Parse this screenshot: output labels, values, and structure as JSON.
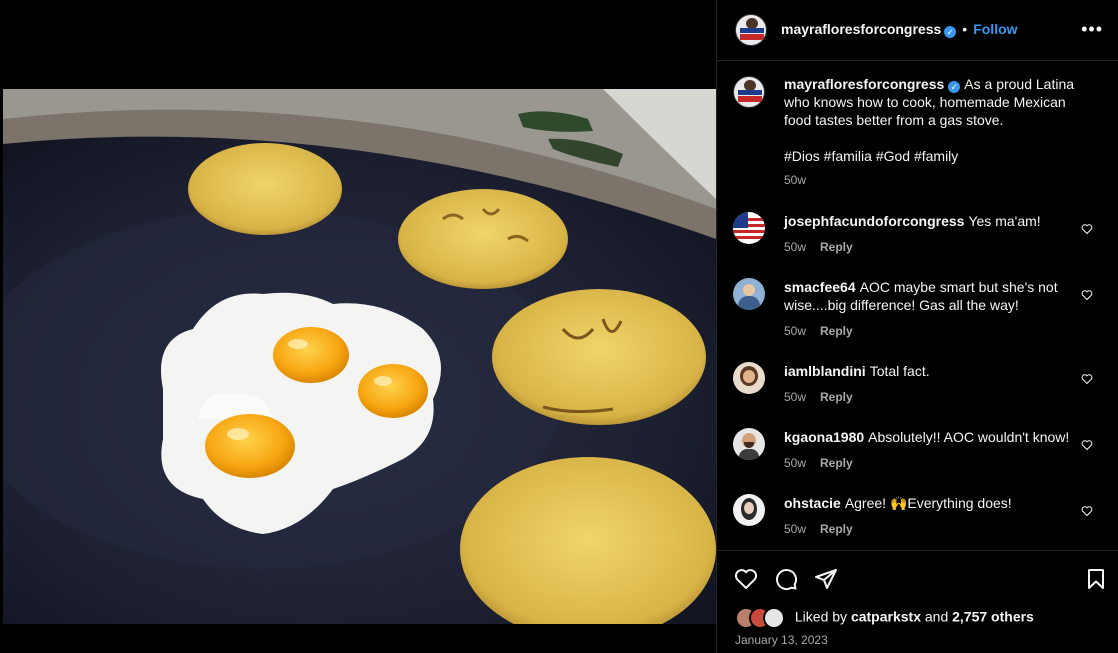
{
  "post": {
    "author": "mayrafloresforcongress",
    "follow_label": "Follow",
    "separator": "•",
    "more_label": "•••",
    "caption_text": "As a proud Latina who knows how to cook, homemade Mexican food tastes better from a gas stove.",
    "hashtags": "#Dios #familia #God #family",
    "caption_time": "50w",
    "verified_glyph": "✓"
  },
  "comments": [
    {
      "user": "josephfacundoforcongress",
      "text": "Yes ma'am!",
      "time": "50w",
      "reply": "Reply"
    },
    {
      "user": "smacfee64",
      "text": "AOC maybe smart but she's not wise....big difference! Gas all the way!",
      "time": "50w",
      "reply": "Reply"
    },
    {
      "user": "iamlblandini",
      "text": "Total fact.",
      "time": "50w",
      "reply": "Reply"
    },
    {
      "user": "kgaona1980",
      "text": "Absolutely!! AOC wouldn't know!",
      "time": "50w",
      "reply": "Reply"
    },
    {
      "user": "ohstacie",
      "text": "Agree! 🙌Everything does!",
      "time": "50w",
      "reply": "Reply"
    }
  ],
  "likes": {
    "prefix": "Liked by",
    "user": "catparkstx",
    "middle": "and",
    "count": "2,757 others"
  },
  "date": "January 13, 2023",
  "icons": {
    "like": "heart-icon",
    "comment": "comment-icon",
    "share": "share-icon",
    "save": "bookmark-icon",
    "more": "more-options-icon"
  },
  "colors": {
    "background": "#000000",
    "accent": "#3897f0",
    "muted": "#a8a8a8",
    "border": "#262626"
  }
}
